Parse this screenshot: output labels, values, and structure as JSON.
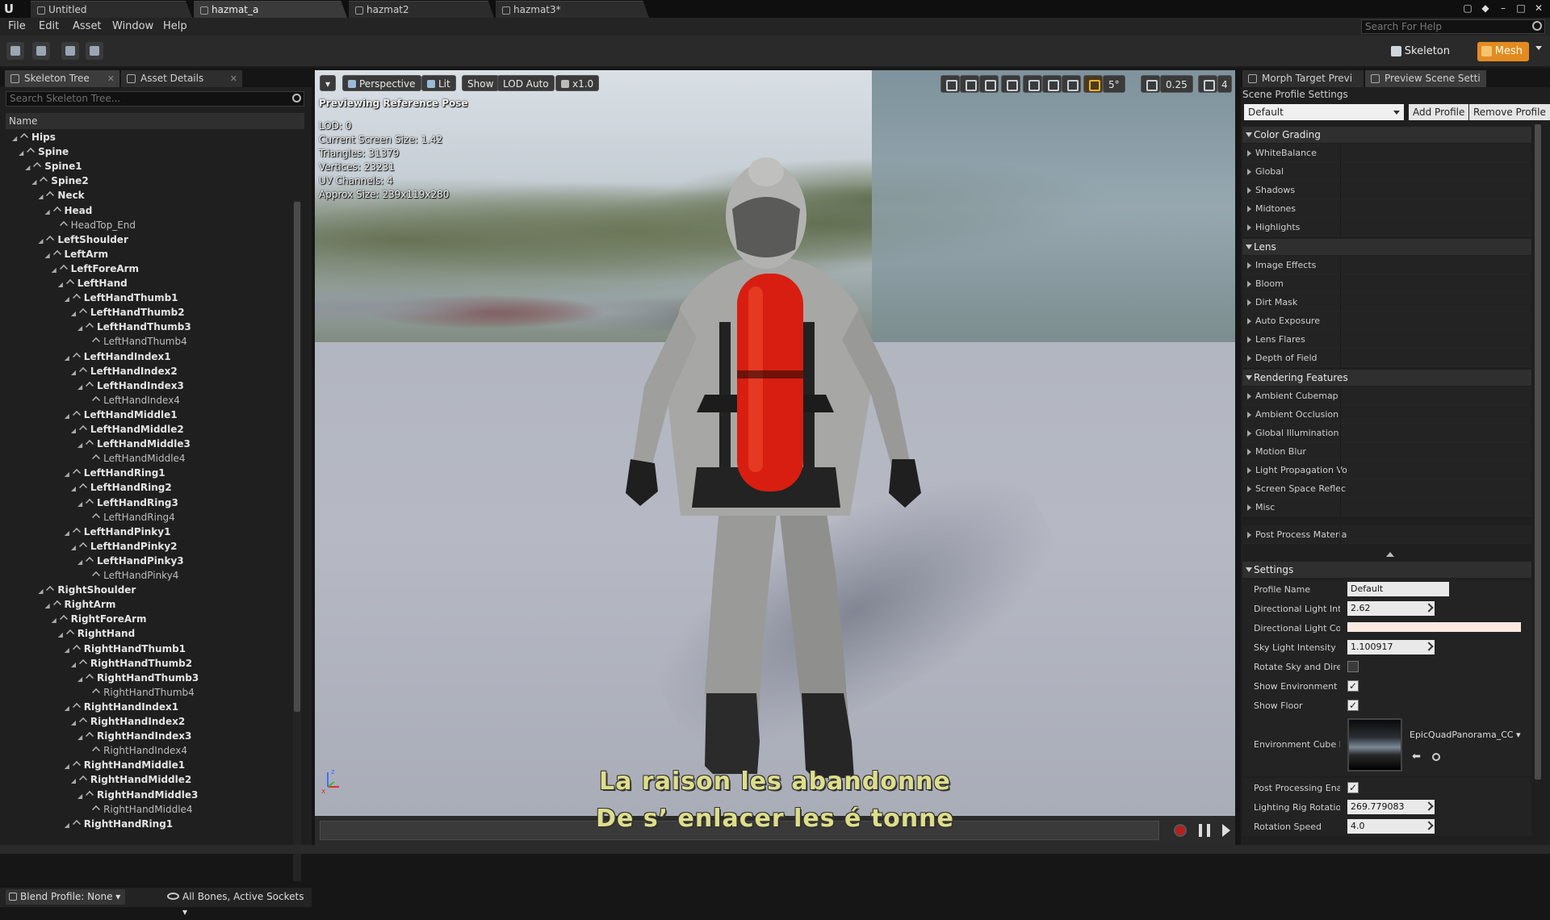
{
  "titlebar": {
    "tabs": [
      {
        "label": "Untitled"
      },
      {
        "label": "hazmat_a"
      },
      {
        "label": "hazmat2"
      },
      {
        "label": "hazmat3*"
      }
    ]
  },
  "menu": {
    "items": [
      "File",
      "Edit",
      "Asset",
      "Window",
      "Help"
    ],
    "search_placeholder": "Search For Help"
  },
  "toolbar": {
    "skeleton_label": "Skeleton",
    "mesh_label": "Mesh"
  },
  "left_panel": {
    "tabs": [
      {
        "label": "Skeleton Tree"
      },
      {
        "label": "Asset Details"
      }
    ],
    "search_placeholder": "Search Skeleton Tree...",
    "column_header": "Name",
    "bones": [
      {
        "label": "Hips",
        "depth": 0,
        "bold": true
      },
      {
        "label": "Spine",
        "depth": 1,
        "bold": true
      },
      {
        "label": "Spine1",
        "depth": 2,
        "bold": true
      },
      {
        "label": "Spine2",
        "depth": 3,
        "bold": true
      },
      {
        "label": "Neck",
        "depth": 4,
        "bold": true
      },
      {
        "label": "Head",
        "depth": 5,
        "bold": true
      },
      {
        "label": "HeadTop_End",
        "depth": 6,
        "bold": false
      },
      {
        "label": "LeftShoulder",
        "depth": 4,
        "bold": true
      },
      {
        "label": "LeftArm",
        "depth": 5,
        "bold": true
      },
      {
        "label": "LeftForeArm",
        "depth": 6,
        "bold": true
      },
      {
        "label": "LeftHand",
        "depth": 7,
        "bold": true
      },
      {
        "label": "LeftHandThumb1",
        "depth": 8,
        "bold": true
      },
      {
        "label": "LeftHandThumb2",
        "depth": 9,
        "bold": true
      },
      {
        "label": "LeftHandThumb3",
        "depth": 10,
        "bold": true
      },
      {
        "label": "LeftHandThumb4",
        "depth": 11,
        "bold": false
      },
      {
        "label": "LeftHandIndex1",
        "depth": 8,
        "bold": true
      },
      {
        "label": "LeftHandIndex2",
        "depth": 9,
        "bold": true
      },
      {
        "label": "LeftHandIndex3",
        "depth": 10,
        "bold": true
      },
      {
        "label": "LeftHandIndex4",
        "depth": 11,
        "bold": false
      },
      {
        "label": "LeftHandMiddle1",
        "depth": 8,
        "bold": true
      },
      {
        "label": "LeftHandMiddle2",
        "depth": 9,
        "bold": true
      },
      {
        "label": "LeftHandMiddle3",
        "depth": 10,
        "bold": true
      },
      {
        "label": "LeftHandMiddle4",
        "depth": 11,
        "bold": false
      },
      {
        "label": "LeftHandRing1",
        "depth": 8,
        "bold": true
      },
      {
        "label": "LeftHandRing2",
        "depth": 9,
        "bold": true
      },
      {
        "label": "LeftHandRing3",
        "depth": 10,
        "bold": true
      },
      {
        "label": "LeftHandRing4",
        "depth": 11,
        "bold": false
      },
      {
        "label": "LeftHandPinky1",
        "depth": 8,
        "bold": true
      },
      {
        "label": "LeftHandPinky2",
        "depth": 9,
        "bold": true
      },
      {
        "label": "LeftHandPinky3",
        "depth": 10,
        "bold": true
      },
      {
        "label": "LeftHandPinky4",
        "depth": 11,
        "bold": false
      },
      {
        "label": "RightShoulder",
        "depth": 4,
        "bold": true
      },
      {
        "label": "RightArm",
        "depth": 5,
        "bold": true
      },
      {
        "label": "RightForeArm",
        "depth": 6,
        "bold": true
      },
      {
        "label": "RightHand",
        "depth": 7,
        "bold": true
      },
      {
        "label": "RightHandThumb1",
        "depth": 8,
        "bold": true
      },
      {
        "label": "RightHandThumb2",
        "depth": 9,
        "bold": true
      },
      {
        "label": "RightHandThumb3",
        "depth": 10,
        "bold": true
      },
      {
        "label": "RightHandThumb4",
        "depth": 11,
        "bold": false
      },
      {
        "label": "RightHandIndex1",
        "depth": 8,
        "bold": true
      },
      {
        "label": "RightHandIndex2",
        "depth": 9,
        "bold": true
      },
      {
        "label": "RightHandIndex3",
        "depth": 10,
        "bold": true
      },
      {
        "label": "RightHandIndex4",
        "depth": 11,
        "bold": false
      },
      {
        "label": "RightHandMiddle1",
        "depth": 8,
        "bold": true
      },
      {
        "label": "RightHandMiddle2",
        "depth": 9,
        "bold": true
      },
      {
        "label": "RightHandMiddle3",
        "depth": 10,
        "bold": true
      },
      {
        "label": "RightHandMiddle4",
        "depth": 11,
        "bold": false
      },
      {
        "label": "RightHandRing1",
        "depth": 8,
        "bold": true
      }
    ],
    "blend_profile": "Blend Profile: None",
    "bones_filter": "All Bones, Active Sockets"
  },
  "viewport": {
    "buttons": {
      "perspective": "Perspective",
      "lit": "Lit",
      "show": "Show",
      "lod": "LOD Auto",
      "speed": "x1.0"
    },
    "right_values": {
      "snap_angle": "5°",
      "scale_snap": "0.25",
      "camera_speed": "4"
    },
    "info": {
      "title": "Previewing Reference Pose",
      "lines": [
        "LOD: 0",
        "Current Screen Size: 1.42",
        "Triangles: 31379",
        "Vertices: 23231",
        "UV Channels: 4",
        "Approx Size: 239x119x280"
      ]
    },
    "subtitles": [
      "La raison les abandonne",
      "De s’ enlacer les é tonne"
    ]
  },
  "right_panel": {
    "tabs": [
      {
        "label": "Morph Target Previ"
      },
      {
        "label": "Preview Scene Setti"
      }
    ],
    "profile_settings_label": "Scene Profile Settings",
    "profile_value": "Default",
    "add_profile": "Add Profile",
    "remove_profile": "Remove Profile",
    "sections": [
      {
        "title": "Color Grading",
        "items": [
          "WhiteBalance",
          "Global",
          "Shadows",
          "Midtones",
          "Highlights"
        ]
      },
      {
        "title": "Lens",
        "items": [
          "Image Effects",
          "Bloom",
          "Dirt Mask",
          "Auto Exposure",
          "Lens Flares",
          "Depth of Field"
        ]
      },
      {
        "title": "Rendering Features",
        "items": [
          "Ambient Cubemap",
          "Ambient Occlusion",
          "Global Illumination",
          "Motion Blur",
          "Light Propagation Vo",
          "Screen Space Reflec",
          "Misc"
        ]
      }
    ],
    "post_process": "Post Process Materia",
    "settings_title": "Settings",
    "settings": {
      "profile_name_label": "Profile Name",
      "profile_name_value": "Default",
      "dir_light_intensity_label": "Directional Light Inter",
      "dir_light_intensity_value": "2.62",
      "dir_light_color_label": "Directional Light Colo",
      "dir_light_color_value": "#fbeae2",
      "sky_light_label": "Sky Light Intensity",
      "sky_light_value": "1.100917",
      "rotate_sky_label": "Rotate Sky and Direct",
      "rotate_sky_checked": false,
      "show_env_label": "Show Environment",
      "show_env_checked": true,
      "show_floor_label": "Show Floor",
      "show_floor_checked": true,
      "env_cube_label": "Environment Cube Ma",
      "env_cube_value": "EpicQuadPanorama_CC",
      "post_processing_label": "Post Processing Enab",
      "post_processing_checked": true,
      "lighting_rig_label": "Lighting Rig Rotation",
      "lighting_rig_value": "269.779083",
      "rotation_speed_label": "Rotation Speed",
      "rotation_speed_value": "4.0"
    }
  },
  "colors": {
    "accent_orange": "#e38b21",
    "record_red": "#b81e1e",
    "subtitle_yellow": "#dede8a",
    "suit_tank_red": "#d81e10"
  }
}
